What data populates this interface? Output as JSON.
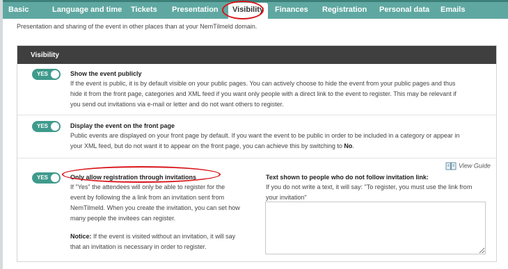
{
  "tabs": [
    {
      "label": "Basic"
    },
    {
      "label": "Language and time"
    },
    {
      "label": "Tickets"
    },
    {
      "label": "Presentation"
    },
    {
      "label": "Visibility"
    },
    {
      "label": "Finances"
    },
    {
      "label": "Registration"
    },
    {
      "label": "Personal data"
    },
    {
      "label": "Emails"
    }
  ],
  "active_tab": "Visibility",
  "intro_text": "Presentation and sharing of the event in other places than at your NemTilmeld domain.",
  "panel": {
    "title": "Visibility",
    "settings": [
      {
        "toggle_label": "YES",
        "title": "Show the event publicly",
        "desc_lines": [
          "If the event is public, it is by default visible on your public pages. You can actively choose to hide the event from your public pages and thus",
          "hide it from the front page, categories and XML feed if you want only people with a direct link to the event to register. This may be relevant if",
          "you send out invitations via e-mail or letter and do not want others to register."
        ]
      },
      {
        "toggle_label": "YES",
        "title": "Display the event on the front page",
        "desc_line1": "Public events are displayed on your front page by default. If you want the event to be public in order to be included in a category or appear in",
        "desc_line2_pre": "your XML feed, but do not want it to appear on the front page, you can achieve this by switching to ",
        "desc_line2_bold": "No",
        "desc_line2_post": "."
      },
      {
        "toggle_label": "YES",
        "title": "Only allow registration through invitations",
        "desc_lines": [
          "If \"Yes\" the attendees will only be able to register for the",
          "event by following the a link from an invitation sent from",
          "NemTilmeld. When you create the invitation, you can set how",
          "many people the invitees can register."
        ],
        "notice_label": "Notice:",
        "notice_line1": " If the event is visited without an invitation, it will say",
        "notice_line2": "that an invitation is necessary in order to register.",
        "view_guide": "View Guide",
        "text_field_label": "Text shown to people who do not follow invitation link:",
        "text_field_help_lines": [
          "If you do not write a text, it will say: \"To register, you must use the link from",
          "your invitation\""
        ],
        "text_field_value": ""
      }
    ]
  },
  "colors": {
    "tab_bar": "#5fa8a1",
    "toggle": "#3f9a8c",
    "panel_header": "#3f3f3f",
    "annotation": "#d9161b"
  }
}
